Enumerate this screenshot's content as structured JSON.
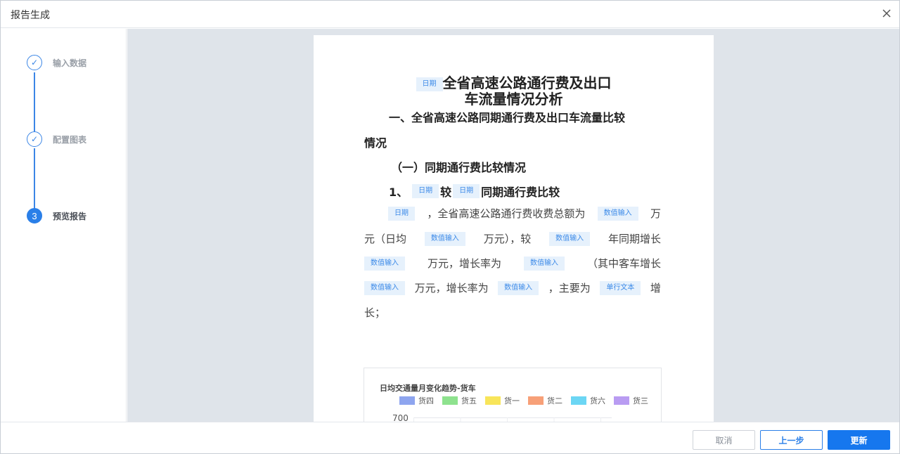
{
  "window": {
    "title": "报告生成"
  },
  "steps": [
    {
      "label": "输入数据",
      "status": "done",
      "marker": "✓"
    },
    {
      "label": "配置图表",
      "status": "done",
      "marker": "✓"
    },
    {
      "label": "预览报告",
      "status": "active",
      "marker": "3"
    }
  ],
  "document": {
    "title_tag": "日期",
    "title_line1": "全省高速公路通行费及出口",
    "title_line2": "车流量情况分析",
    "section1_a": "一、全省高速公路同期通行费及出口车流量比较",
    "section1_b": "情况",
    "subsection1": "（一）同期通行费比较情况",
    "item1": {
      "prefix": "1、",
      "tag1": "日期",
      "mid": "较",
      "tag2": "日期",
      "suffix": "同期通行费比较"
    },
    "paragraph": {
      "line1": {
        "tag1": "日期",
        "t1": "，全省高速公路通行费收费总额为",
        "tag2": "数值输入",
        "t2": "万"
      },
      "line2": {
        "t1": "元（日均",
        "tag1": "数值输入",
        "t2": "万元），较",
        "tag2": "数值输入",
        "t3": "年同期增长"
      },
      "line3": {
        "tag1": "数值输入",
        "t1": "万元，增长率为",
        "tag2": "数值输入",
        "t2": "（其中客车增长"
      },
      "line4": {
        "tag1": "数值输入",
        "t1": "万元，增长率为",
        "tag2": "数值输入",
        "t2": "，主要为",
        "tag3": "单行文本",
        "t3": "增"
      },
      "line5": {
        "t1": "长；"
      }
    }
  },
  "chart_data": {
    "type": "line",
    "title": "日均交通量月变化趋势-货车",
    "series": [
      {
        "name": "货四",
        "color": "#8ea5ef"
      },
      {
        "name": "货五",
        "color": "#8ee28e"
      },
      {
        "name": "货一",
        "color": "#f8e55a"
      },
      {
        "name": "货二",
        "color": "#f7a078"
      },
      {
        "name": "货六",
        "color": "#6cd6f4"
      },
      {
        "name": "货三",
        "color": "#b99cf2"
      }
    ],
    "y_ticks_visible": [
      "700"
    ]
  },
  "footer": {
    "cancel_label": "取消",
    "prev_label": "上一步",
    "update_label": "更新"
  },
  "colors": {
    "accent": "#1677ee",
    "tag_bg": "#e6f1fc",
    "tag_text": "#3c8ae8",
    "canvas_bg": "#dfe4ea"
  }
}
